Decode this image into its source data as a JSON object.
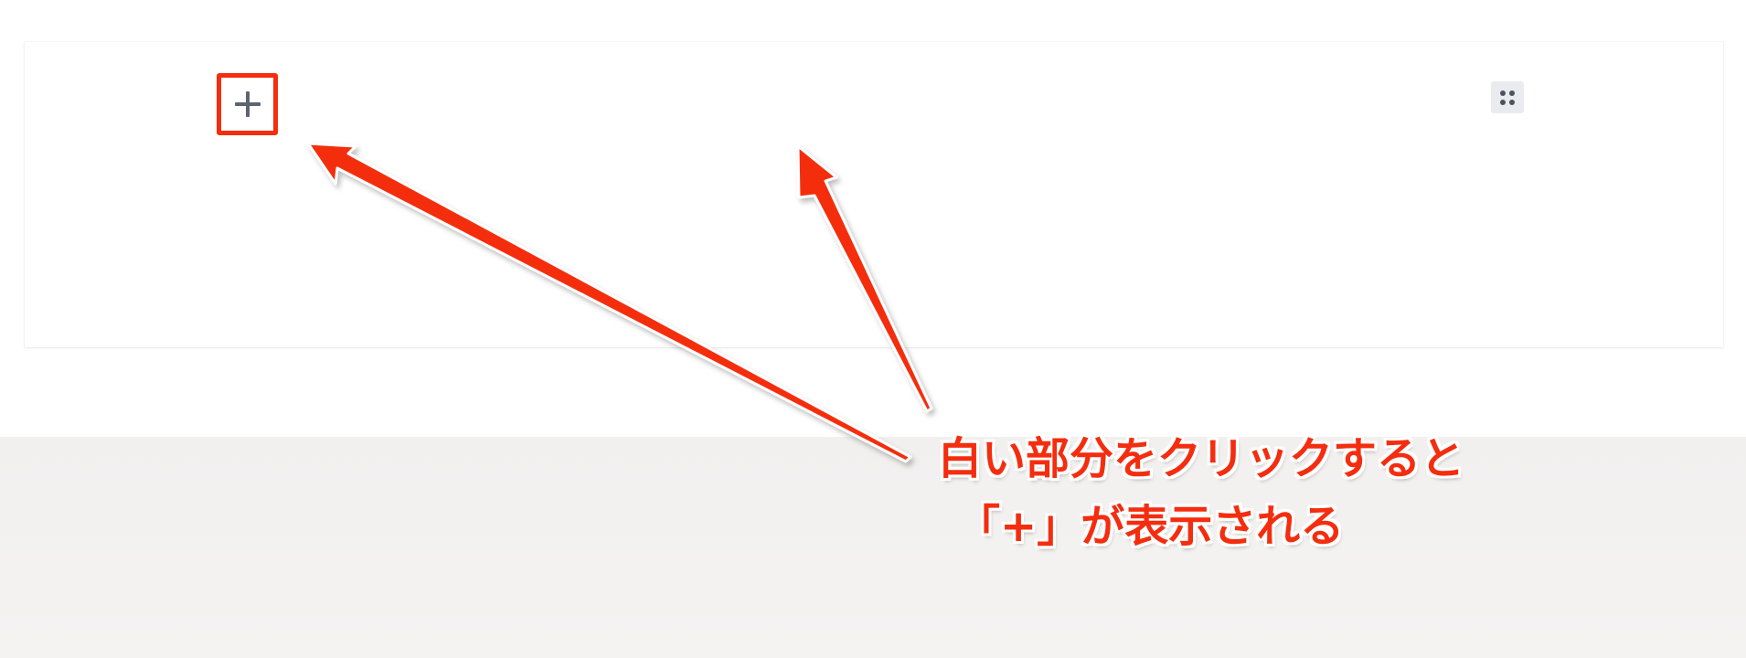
{
  "editor": {
    "add_block_button": {
      "label": "+",
      "icon": "plus-icon"
    },
    "drag_handle": {
      "icon": "drag-handle-icon"
    }
  },
  "annotation": {
    "line_1": "白い部分をクリックすると",
    "line_2": "「+」が表示される",
    "color": "#f42d0f"
  },
  "colors": {
    "annotation_red": "#f42d0f",
    "icon_gray": "#5c6470",
    "handle_bg": "#e9ebee",
    "page_bottom": "#f1f0ef"
  }
}
